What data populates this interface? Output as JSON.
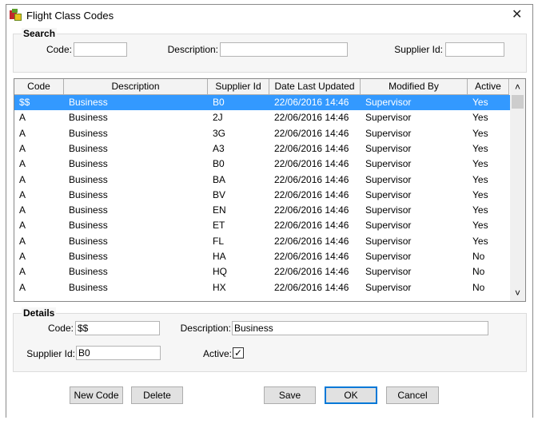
{
  "window": {
    "title": "Flight Class Codes",
    "app_icon": "app-icon",
    "close_icon": "close-icon"
  },
  "search": {
    "title": "Search",
    "code_label": "Code:",
    "code_value": "",
    "description_label": "Description:",
    "description_value": "",
    "supplier_label": "Supplier Id:",
    "supplier_value": ""
  },
  "table": {
    "columns": [
      "Code",
      "Description",
      "Supplier Id",
      "Date Last Updated",
      "Modified By",
      "Active"
    ],
    "rows": [
      [
        "$$",
        "Business",
        "B0",
        "22/06/2016 14:46",
        "Supervisor",
        "Yes"
      ],
      [
        "A",
        "Business",
        "2J",
        "22/06/2016 14:46",
        "Supervisor",
        "Yes"
      ],
      [
        "A",
        "Business",
        "3G",
        "22/06/2016 14:46",
        "Supervisor",
        "Yes"
      ],
      [
        "A",
        "Business",
        "A3",
        "22/06/2016 14:46",
        "Supervisor",
        "Yes"
      ],
      [
        "A",
        "Business",
        "B0",
        "22/06/2016 14:46",
        "Supervisor",
        "Yes"
      ],
      [
        "A",
        "Business",
        "BA",
        "22/06/2016 14:46",
        "Supervisor",
        "Yes"
      ],
      [
        "A",
        "Business",
        "BV",
        "22/06/2016 14:46",
        "Supervisor",
        "Yes"
      ],
      [
        "A",
        "Business",
        "EN",
        "22/06/2016 14:46",
        "Supervisor",
        "Yes"
      ],
      [
        "A",
        "Business",
        "ET",
        "22/06/2016 14:46",
        "Supervisor",
        "Yes"
      ],
      [
        "A",
        "Business",
        "FL",
        "22/06/2016 14:46",
        "Supervisor",
        "Yes"
      ],
      [
        "A",
        "Business",
        "HA",
        "22/06/2016 14:46",
        "Supervisor",
        "No"
      ],
      [
        "A",
        "Business",
        "HQ",
        "22/06/2016 14:46",
        "Supervisor",
        "No"
      ],
      [
        "A",
        "Business",
        "HX",
        "22/06/2016 14:46",
        "Supervisor",
        "No"
      ]
    ],
    "selected_index": 0,
    "scroll_up": "˄",
    "scroll_down": "˅"
  },
  "details": {
    "title": "Details",
    "code_label": "Code:",
    "code_value": "$$",
    "description_label": "Description:",
    "description_value": "Business",
    "supplier_label": "Supplier Id:",
    "supplier_value": "B0",
    "active_label": "Active:",
    "active_checked": true,
    "check_glyph": "✓"
  },
  "buttons": {
    "new_code": "New Code",
    "delete": "Delete",
    "save": "Save",
    "ok": "OK",
    "cancel": "Cancel"
  }
}
